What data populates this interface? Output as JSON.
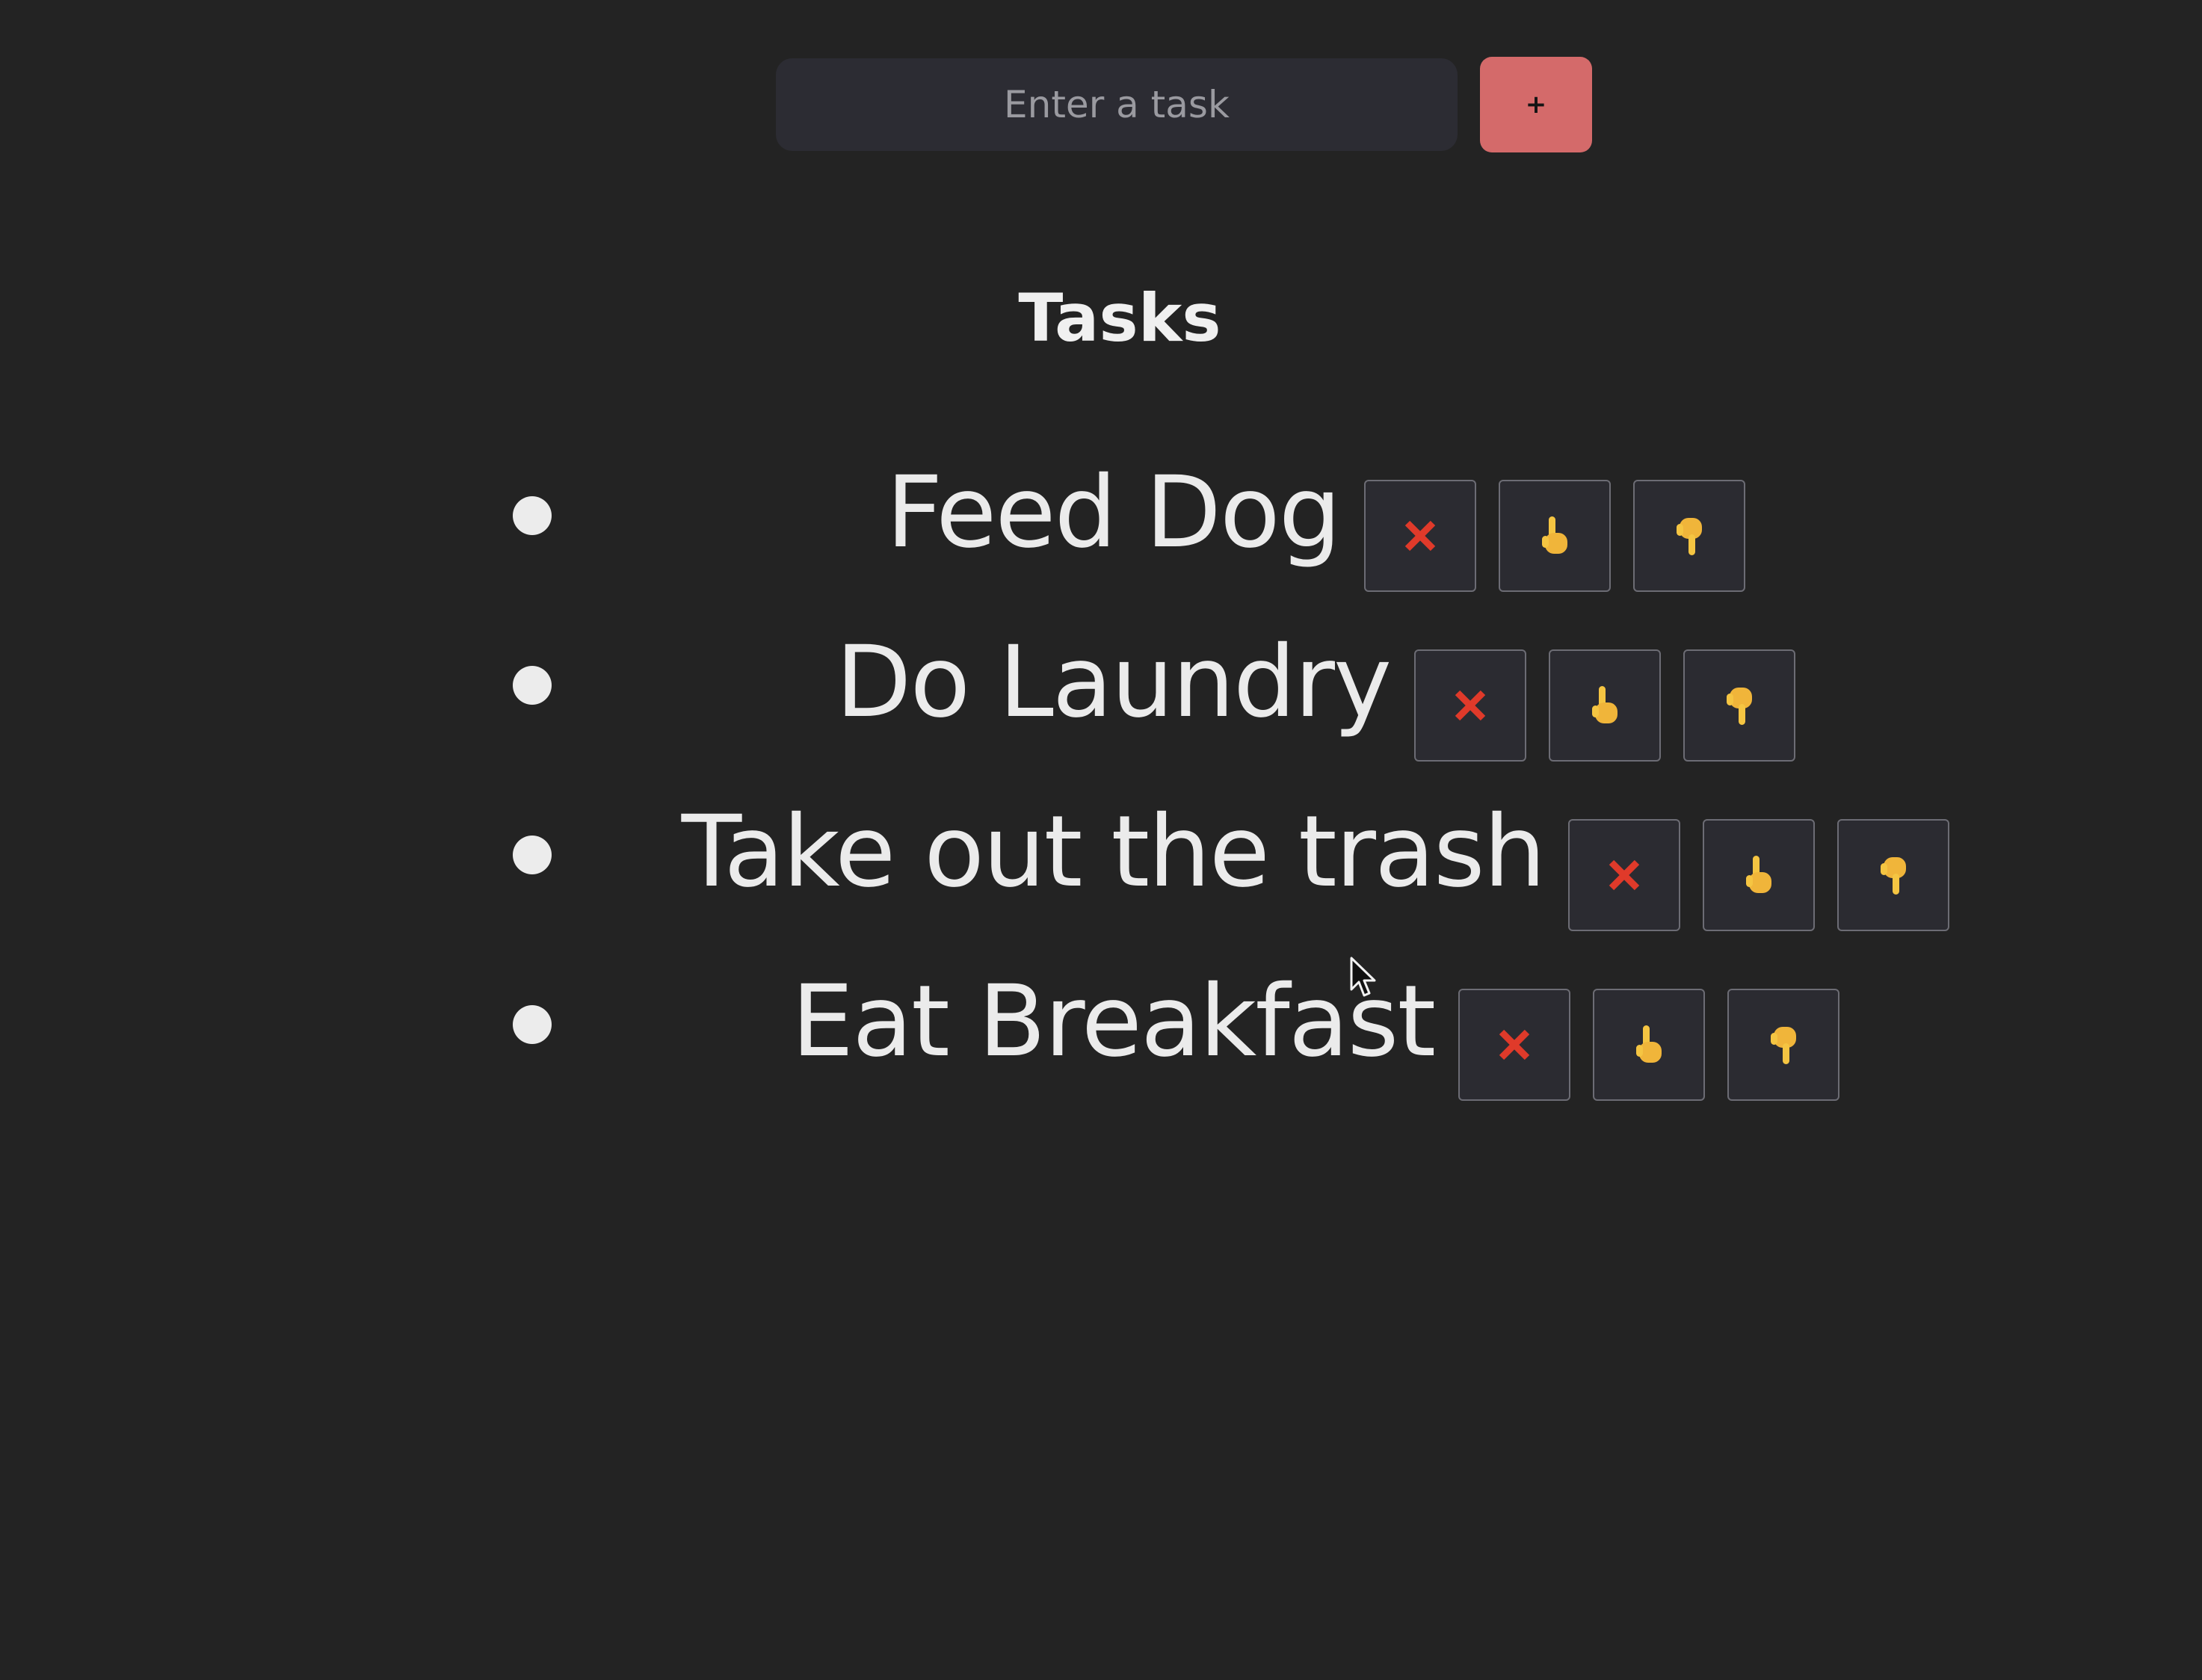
{
  "input": {
    "placeholder": "Enter a task",
    "value": ""
  },
  "add_button": {
    "label": "+"
  },
  "heading": "Tasks",
  "tasks": [
    {
      "text": "Feed Dog"
    },
    {
      "text": "Do Laundry"
    },
    {
      "text": "Take out the trash"
    },
    {
      "text": "Eat Breakfast"
    }
  ],
  "task_buttons": [
    {
      "name": "delete",
      "icon": "cross-mark-icon",
      "glyph": "❌"
    },
    {
      "name": "move-up",
      "icon": "pointing-up-hand-icon",
      "glyph": "👆"
    },
    {
      "name": "move-down",
      "icon": "pointing-down-hand-icon",
      "glyph": "👇"
    }
  ],
  "colors": {
    "background": "#232323",
    "input_background": "#2c2c33",
    "add_button": "#d46a6a",
    "task_text": "#ebebeb",
    "delete_icon": "#e03a2a",
    "hand_icon": "#f5c542"
  }
}
